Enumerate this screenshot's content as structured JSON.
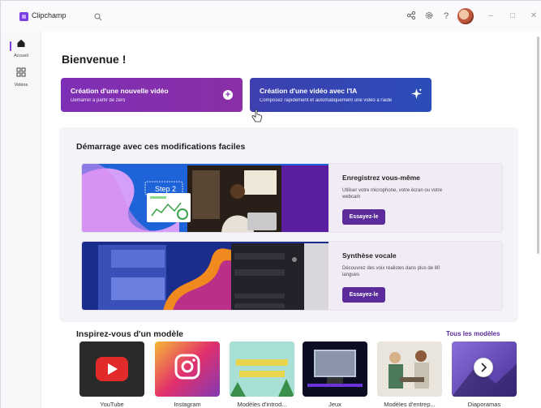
{
  "app": {
    "name": "Clipchamp"
  },
  "titlebar": {
    "icons": [
      "search-icon",
      "share-icon",
      "gear-icon",
      "help-icon",
      "avatar",
      "minimize-icon",
      "maximize-icon",
      "close-icon"
    ],
    "help_glyph": "?"
  },
  "rail": {
    "items": [
      {
        "label": "Accueil",
        "icon": "home-icon"
      },
      {
        "label": "Vidéos",
        "icon": "grid-icon"
      }
    ]
  },
  "main": {
    "title": "Bienvenue !",
    "ctas": [
      {
        "title": "Création d'une nouvelle vidéo",
        "subtitle": "Démarrer à partir de zéro",
        "icon": "plus-icon",
        "color": "#7d2fb5"
      },
      {
        "title": "Création d'une vidéo avec l'IA",
        "subtitle": "Composez rapidement et automatiquement une vidéo à l'aide",
        "icon": "sparkle-icon",
        "color": "#2b4db8"
      }
    ],
    "section": {
      "title": "Démarrage avec ces modifications faciles",
      "features": [
        {
          "title": "Enregistrez vous-même",
          "description": "Utiliser votre microphone, votre écran ou votre webcam",
          "button": "Essayez-le",
          "art_step": "Step 2"
        },
        {
          "title": "Synthèse vocale",
          "description": "Découvrez des voix réalistes dans plus de 80 langues",
          "button": "Essayez-le",
          "art_panel": [
            "Language",
            "English (United States)",
            "Voice",
            "Jenny Multilingual",
            "Emotion",
            "Pitch"
          ]
        }
      ]
    },
    "templates": {
      "title": "Inspirez-vous d'un modèle",
      "link": "Tous les modèles",
      "items": [
        {
          "label": "YouTube"
        },
        {
          "label": "Instagram"
        },
        {
          "label": "Modèles d'introd..."
        },
        {
          "label": "Jeux"
        },
        {
          "label": "Modèles d'entrep..."
        },
        {
          "label": "Diaporamas"
        }
      ],
      "next_icon": "chevron-right-icon"
    }
  },
  "colors": {
    "accent": "#5b2b9b",
    "brand": "#7a3ee0"
  }
}
